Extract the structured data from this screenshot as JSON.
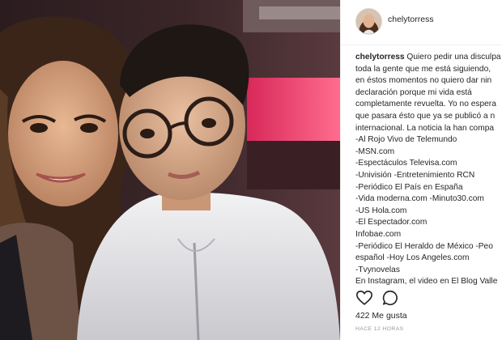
{
  "post": {
    "username": "chelytorress",
    "caption_author": "chelytorress",
    "caption_lines": [
      " Quiero pedir una disculpa",
      "toda la gente que me está siguiendo,",
      "en éstos momentos no quiero dar nin",
      "declaración porque mi vida está",
      "completamente revuelta. Yo no espera",
      "que pasara ésto que ya se publicó a n",
      "internacional. La noticia la han compa",
      "-Al Rojo Vivo de Telemundo",
      "-MSN.com",
      "-Espectáculos Televisa.com",
      "-Univisión -Entretenimiento RCN",
      "-Periódico El País en España",
      "-Vida moderna.com -Minuto30.com",
      "-US Hola.com",
      "-El Espectador.com",
      "Infobae.com",
      "-Periódico El Heraldo de México -Peo",
      "español -Hoy Los Angeles.com",
      "-Tvynovelas",
      "En Instagram, el video en El Blog Valle"
    ],
    "likes_label": "422 Me gusta",
    "timestamp": "HACE 12 HORAS"
  },
  "icons": {
    "like": "heart-icon",
    "comment": "comment-icon"
  },
  "colors": {
    "text": "#262626",
    "muted": "#999999",
    "border": "#efefef"
  }
}
